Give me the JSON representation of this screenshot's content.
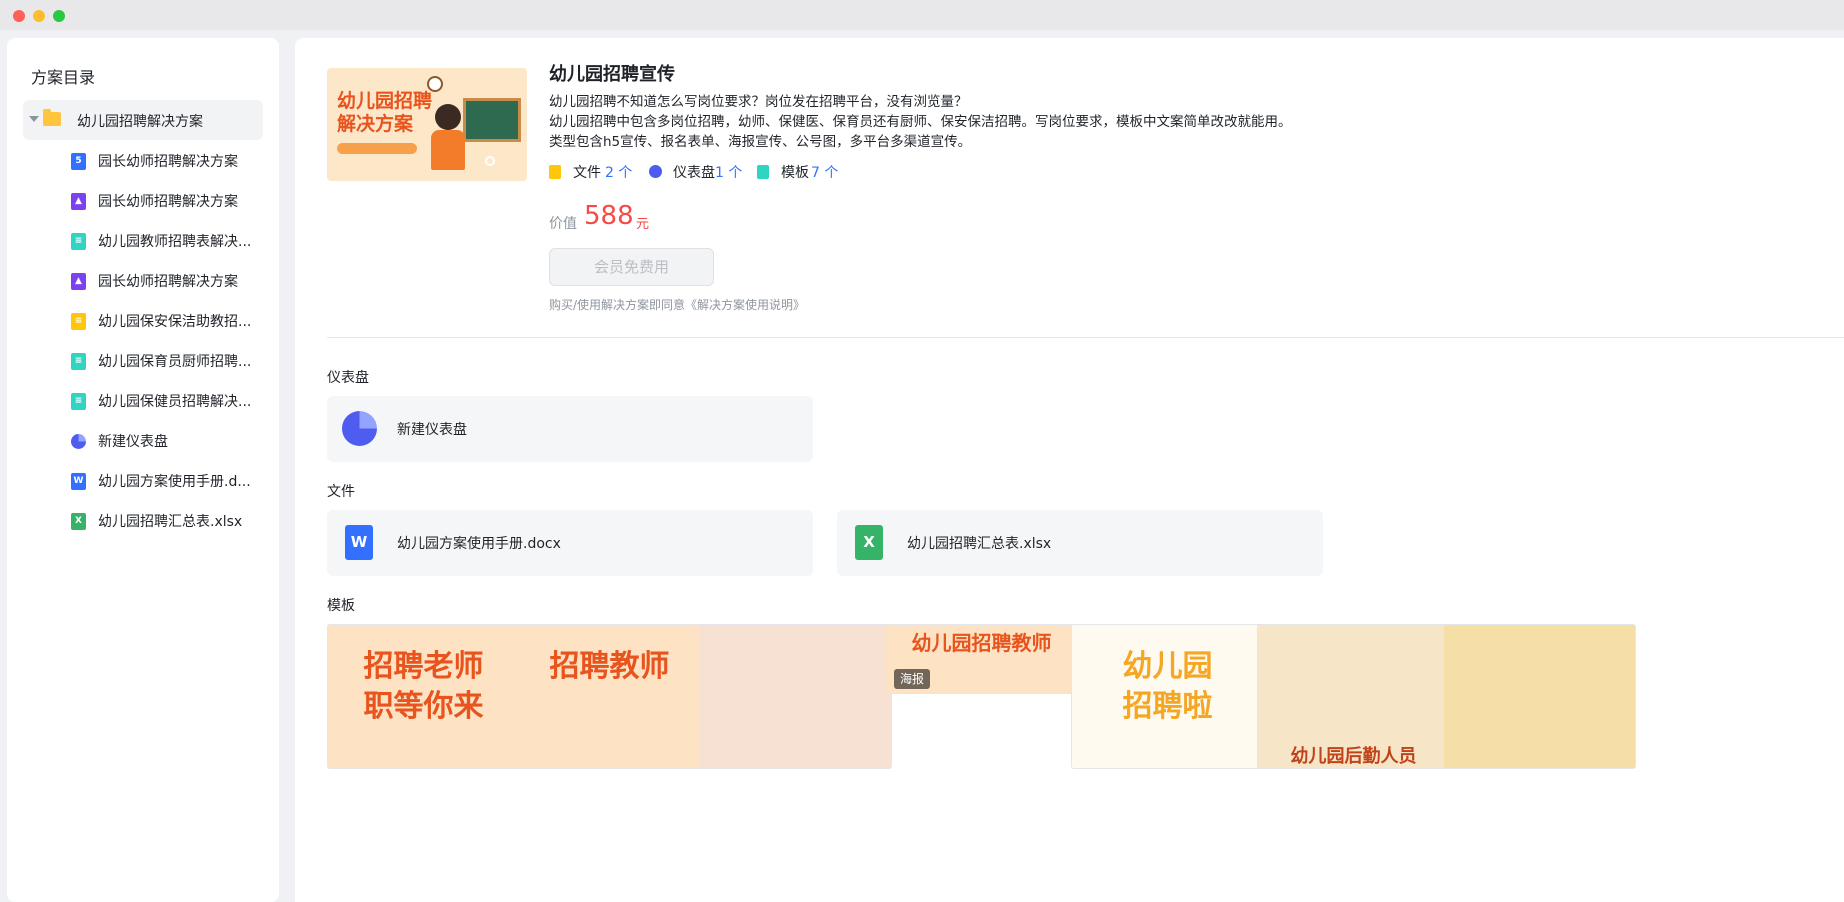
{
  "sidebar": {
    "title": "方案目录",
    "root": "幼儿园招聘解决方案",
    "items": [
      {
        "label": "园长幼师招聘解决方案",
        "icon": "h5-icon",
        "color": "#3370ff",
        "glyph": "5"
      },
      {
        "label": "园长幼师招聘解决方案",
        "icon": "poster-image-icon",
        "color": "#7b42f0",
        "glyph": "▲"
      },
      {
        "label": "幼儿园教师招聘表解决...",
        "icon": "form-icon",
        "color": "#2fd4c2",
        "glyph": "≡"
      },
      {
        "label": "园长幼师招聘解决方案",
        "icon": "poster-image-icon",
        "color": "#7b42f0",
        "glyph": "▲"
      },
      {
        "label": "幼儿园保安保洁助教招...",
        "icon": "announcement-icon",
        "color": "#ffc60a",
        "glyph": "≡"
      },
      {
        "label": "幼儿园保育员厨师招聘...",
        "icon": "form-icon",
        "color": "#2fd4c2",
        "glyph": "≡"
      },
      {
        "label": "幼儿园保健员招聘解决...",
        "icon": "form-icon",
        "color": "#2fd4c2",
        "glyph": "≡"
      },
      {
        "label": "新建仪表盘",
        "icon": "dashboard-pie-icon",
        "color": "#4e5cf0",
        "glyph": ""
      },
      {
        "label": "幼儿园方案使用手册.d...",
        "icon": "word-doc-icon",
        "color": "#3370ff",
        "glyph": "W"
      },
      {
        "label": "幼儿园招聘汇总表.xlsx",
        "icon": "excel-icon",
        "color": "#34b369",
        "glyph": "X"
      }
    ]
  },
  "header": {
    "title": "幼儿园招聘宣传",
    "desc_lines": [
      "幼儿园招聘不知道怎么写岗位要求？岗位发在招聘平台，没有浏览量？",
      "幼儿园招聘中包含多岗位招聘，幼师、保健医、保育员还有厨师、保安保洁招聘。写岗位要求，模板中文案简单改改就能用。",
      "类型包含h5宣传、报名表单、海报宣传、公号图，多平台多渠道宣传。"
    ],
    "stats": [
      {
        "name": "文件",
        "count": "2 个",
        "icon": "file-icon",
        "color": "#ffc60a"
      },
      {
        "name": "仪表盘",
        "count": "1 个",
        "icon": "dashboard-icon",
        "color": "#4e5cf0"
      },
      {
        "name": "模板",
        "count": "7 个",
        "icon": "template-icon",
        "color": "#2fd4c2"
      }
    ],
    "cover_title": "幼儿园招聘\n解决方案",
    "price_label": "价值",
    "price": "588",
    "price_unit": "元",
    "button": "会员免费用",
    "agreement": "购买/使用解决方案即同意《解决方案使用说明》"
  },
  "sections": {
    "dashboard": {
      "title": "仪表盘",
      "items": [
        "新建仪表盘"
      ]
    },
    "files": {
      "title": "文件",
      "items": [
        {
          "label": "幼儿园方案使用手册.docx",
          "glyph": "W",
          "color": "#3370ff"
        },
        {
          "label": "幼儿园招聘汇总表.xlsx",
          "glyph": "X",
          "color": "#34b369"
        }
      ]
    },
    "templates": {
      "title": "模板",
      "items": [
        {
          "text": "招聘老师\n职等你来",
          "bg": "#fde3c4"
        },
        {
          "text": "招聘教师",
          "bg": "#fde3c4"
        },
        {
          "text": "",
          "bg": "#f6e1d3"
        },
        {
          "text": "幼儿园招聘教师",
          "bg": "#fde3c4",
          "badge": "海报"
        },
        {
          "text": "幼儿园\n招聘啦",
          "bg": "#fffaf0"
        },
        {
          "text": "幼儿园后勤人员",
          "bg": "#f7e5c8"
        },
        {
          "text": "",
          "bg": "#f6dfa7"
        }
      ]
    }
  },
  "window_colors": {
    "close": "#ff5f57",
    "minimize": "#febc2e",
    "zoom": "#28c840"
  }
}
